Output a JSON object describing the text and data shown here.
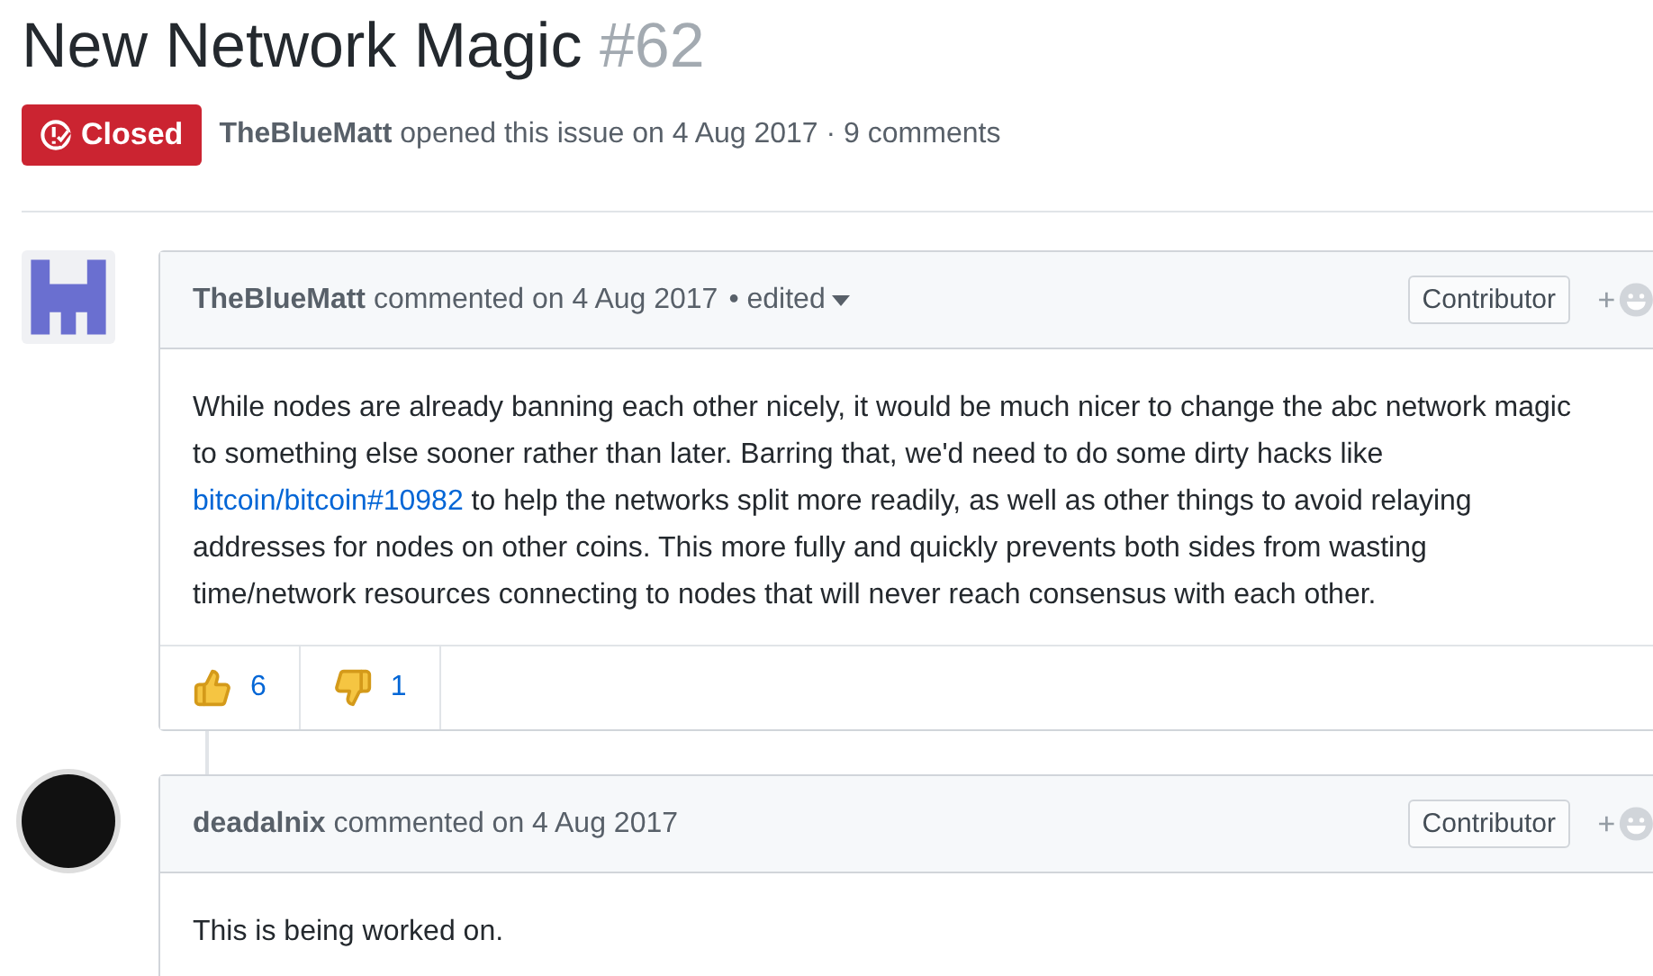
{
  "issue": {
    "title": "New Network Magic",
    "number": "#62",
    "state": {
      "kind": "closed",
      "label": "Closed"
    },
    "author": "TheBlueMatt",
    "meta": "opened this issue on 4 Aug 2017 · 9 comments"
  },
  "comments": [
    {
      "avatar": {
        "kind": "identicon"
      },
      "author": "TheBlueMatt",
      "meta": "commented on 4 Aug 2017",
      "edited": "• edited",
      "role": "Contributor",
      "body": "While nodes are already banning each other nicely, it would be much nicer to change the abc network magic to something else sooner rather than later. Barring that, we'd need to do some dirty hacks like ",
      "link": "bitcoin/bitcoin#10982",
      "body_after": " to help the networks split more readily, as well as other things to avoid relaying addresses for nodes on other coins. This more fully and quickly prevents both sides from wasting time/network resources connecting to nodes that will never reach consensus with each other.",
      "reactions": [
        {
          "kind": "thumbs-up",
          "count": "6"
        },
        {
          "kind": "thumbs-down",
          "count": "1"
        }
      ]
    },
    {
      "avatar": {
        "kind": "round"
      },
      "author": "deadalnix",
      "meta": "commented on 4 Aug 2017",
      "role": "Contributor",
      "body": "This is being worked on."
    }
  ]
}
